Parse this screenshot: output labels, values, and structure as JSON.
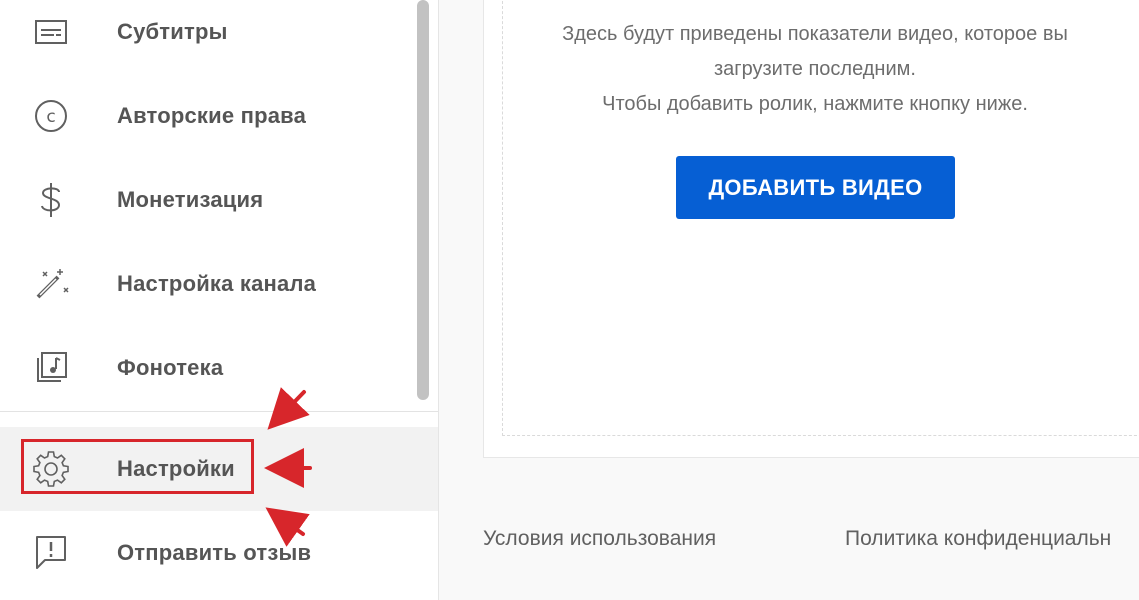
{
  "sidebar": {
    "items": [
      {
        "label": "Субтитры",
        "icon": "subtitles-icon"
      },
      {
        "label": "Авторские права",
        "icon": "copyright-icon"
      },
      {
        "label": "Монетизация",
        "icon": "dollar-icon"
      },
      {
        "label": "Настройка канала",
        "icon": "magic-wand-icon"
      },
      {
        "label": "Фонотека",
        "icon": "audio-library-icon"
      }
    ],
    "settings": {
      "label": "Настройки",
      "icon": "gear-icon"
    },
    "feedback": {
      "label": "Отправить отзыв",
      "icon": "feedback-icon"
    }
  },
  "main": {
    "empty_state": {
      "line1": "Здесь будут приведены показатели видео, которое вы",
      "line2": "загрузите последним.",
      "line3": "Чтобы добавить ролик, нажмите кнопку ниже."
    },
    "add_video_label": "ДОБАВИТЬ ВИДЕО"
  },
  "footer": {
    "terms": "Условия использования",
    "privacy": "Политика конфиденциальн"
  },
  "colors": {
    "accent": "#065fd4",
    "annotation": "#d7262b"
  }
}
